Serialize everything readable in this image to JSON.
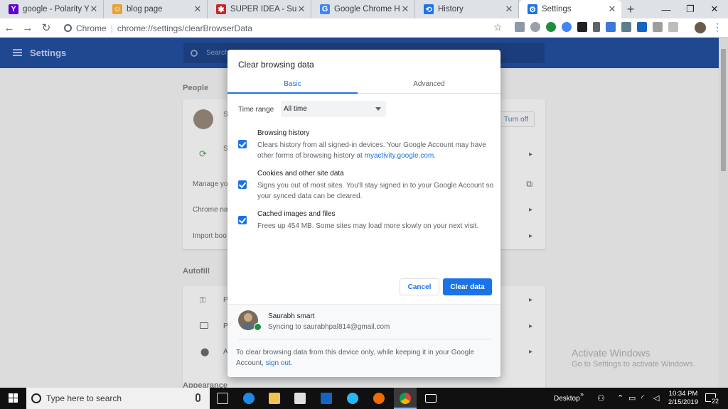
{
  "browser": {
    "tabs": [
      {
        "title": "google - Polarity Yahoo",
        "favicon": "yahoo-icon",
        "color": "#6001d2",
        "glyph": "Y"
      },
      {
        "title": "blog page",
        "favicon": "person-icon",
        "color": "#e8a23a",
        "glyph": "☺"
      },
      {
        "title": "SUPER IDEA - Super ide",
        "favicon": "star-logo-icon",
        "color": "#c62828",
        "glyph": "✱"
      },
      {
        "title": "Google Chrome Histor",
        "favicon": "google-icon",
        "color": "#4285f4",
        "glyph": "G"
      },
      {
        "title": "History",
        "favicon": "history-icon",
        "color": "#1a73e8",
        "glyph": "⟲"
      },
      {
        "title": "Settings",
        "favicon": "gear-icon",
        "color": "#1a73e8",
        "glyph": "⚙"
      }
    ],
    "omnibox": {
      "chip": "Chrome",
      "url": "chrome://settings/clearBrowserData"
    }
  },
  "settings": {
    "title": "Settings",
    "search_placeholder": "Search",
    "people_title": "People",
    "people_rows": [
      "S",
      "S",
      "Manage yo",
      "Chrome na",
      "Import boo"
    ],
    "turn_off": "Turn off",
    "autofill_title": "Autofill",
    "autofill_rows": [
      "P",
      "P",
      "A"
    ],
    "appearance_title": "Appearance"
  },
  "dialog": {
    "title": "Clear browsing data",
    "tab_basic": "Basic",
    "tab_advanced": "Advanced",
    "time_range_label": "Time range",
    "time_range_value": "All time",
    "options": [
      {
        "title": "Browsing history",
        "desc_pre": "Clears history from all signed-in devices. Your Google Account may have other forms of browsing history at ",
        "link": "myactivity.google.com",
        "desc_post": ".",
        "checked": true
      },
      {
        "title": "Cookies and other site data",
        "desc_pre": "Signs you out of most sites. You'll stay signed in to your Google Account so your synced data can be cleared.",
        "link": "",
        "desc_post": "",
        "checked": true
      },
      {
        "title": "Cached images and files",
        "desc_pre": "Frees up 454 MB. Some sites may load more slowly on your next visit.",
        "link": "",
        "desc_post": "",
        "checked": true
      }
    ],
    "cancel": "Cancel",
    "clear": "Clear data",
    "account_name": "Saurabh smart",
    "account_sync": "Syncing to saurabhpal814@gmail.com",
    "footer_pre": "To clear browsing data from this device only, while keeping it in your Google Account, ",
    "footer_link": "sign out",
    "footer_post": "."
  },
  "watermark": {
    "line1": "Activate Windows",
    "line2": "Go to Settings to activate Windows."
  },
  "taskbar": {
    "search_placeholder": "Type here to search",
    "desktop_label": "Desktop",
    "time": "10:34 PM",
    "date": "2/15/2019",
    "notifications": "22"
  },
  "colors": {
    "accent": "#1a73e8",
    "appbar": "#204891"
  }
}
